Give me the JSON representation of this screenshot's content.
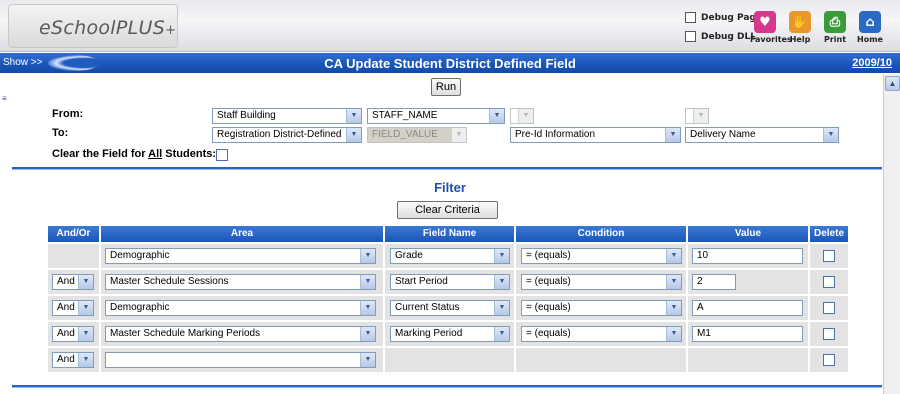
{
  "app": {
    "logo": "eSchool",
    "logo_plus_word": "PLUS",
    "logo_plus_sign": "+",
    "debug_page": "Debug Page",
    "debug_dll": "Debug DLL",
    "buttons": {
      "favorites": "Favorites",
      "help": "Help",
      "print": "Print",
      "home": "Home"
    }
  },
  "titlebar": {
    "show": "Show >>",
    "title": "CA Update Student District Defined Field",
    "year": "2009/10"
  },
  "run_label": "Run",
  "form": {
    "from_label": "From:",
    "to_label": "To:",
    "clear_label_pre": "Clear the Field for ",
    "clear_label_all": "All",
    "clear_label_post": " Students:",
    "from_table": "Staff Building",
    "from_field": "STAFF_NAME",
    "to_table": "Registration District-Defined",
    "to_field": "FIELD_VALUE",
    "to_screen": "Pre-Id Information",
    "to_name": "Delivery Name"
  },
  "filter": {
    "title": "Filter",
    "clear_criteria": "Clear Criteria",
    "columns": [
      "And/Or",
      "Area",
      "Field Name",
      "Condition",
      "Value",
      "Delete"
    ],
    "rows": [
      {
        "andor": "",
        "area": "Demographic",
        "field": "Grade",
        "condition": "= (equals)",
        "value": "10"
      },
      {
        "andor": "And",
        "area": "Master Schedule Sessions",
        "field": "Start Period",
        "condition": "= (equals)",
        "value": "2"
      },
      {
        "andor": "And",
        "area": "Demographic",
        "field": "Current Status",
        "condition": "= (equals)",
        "value": "A"
      },
      {
        "andor": "And",
        "area": "Master Schedule Marking Periods",
        "field": "Marking Period",
        "condition": "= (equals)",
        "value": "M1"
      },
      {
        "andor": "And",
        "area": "",
        "field": "",
        "condition": "",
        "value": ""
      }
    ]
  },
  "colors": {
    "accent": "#1b56b8",
    "header_bg": "#e9e9ee"
  }
}
